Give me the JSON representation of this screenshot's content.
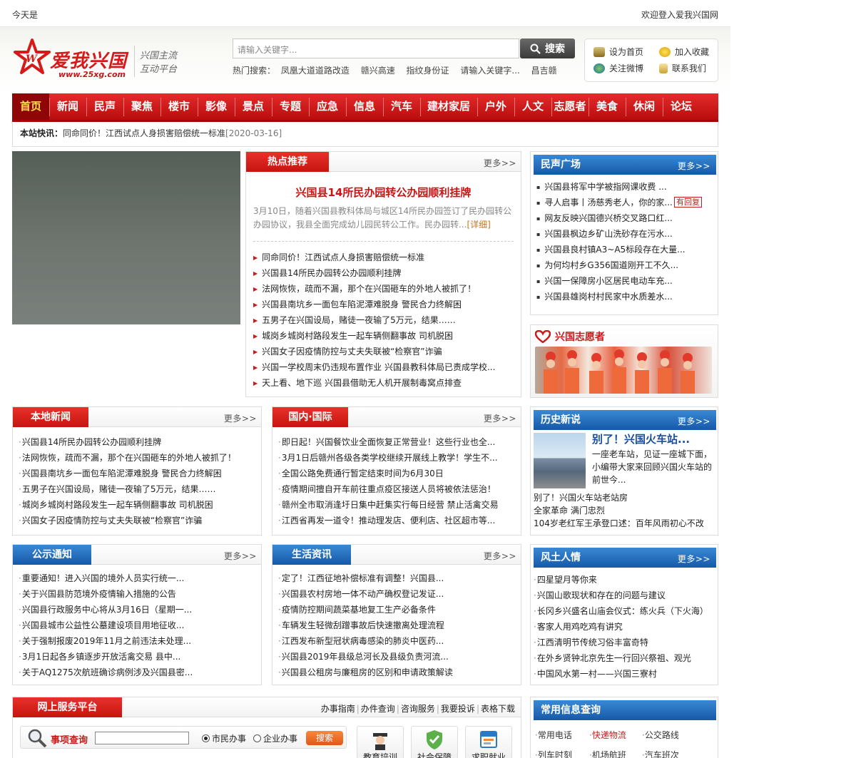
{
  "topbar": {
    "left_text": "今天是",
    "right_text": "欢迎登入爱我兴国网"
  },
  "header": {
    "logo_text": "爱我兴国",
    "logo_url": "www.25xg.com",
    "slogan_1": "兴国主流",
    "slogan_2": "互动平台",
    "search_placeholder": "请输入关键字...",
    "search_button": "搜索",
    "hot_label": "热门搜索：",
    "hot_terms": [
      "凤凰大道道路改造",
      "赣兴高速",
      "指纹身份证",
      "请输入关键字...",
      "昌吉赣"
    ],
    "tools": {
      "homepage": "设为首页",
      "favorite": "加入收藏",
      "weibo": "关注微博",
      "contact": "联系我们"
    }
  },
  "nav": [
    "首页",
    "新闻",
    "民声",
    "聚焦",
    "楼市",
    "影像",
    "景点",
    "专题",
    "应急",
    "信息",
    "汽车",
    "建材家居",
    "户外",
    "人文",
    "志愿者",
    "美食",
    "休闲",
    "论坛"
  ],
  "flash": {
    "label": "本站快讯：",
    "text": "同命同价！江西试点人身损害赔偿统一标准",
    "date": "[2020-03-16]"
  },
  "hot": {
    "tab": "热点推荐",
    "more": "更多>>",
    "title": "兴国县14所民办园转公办园顺利挂牌",
    "desc": "3月10日，随着兴国县教科体局与城区14所民办园签订了民办园转公办园协议，我县全面完成幼儿园民转公工作。民办园转...",
    "detail": "[详细]",
    "items": [
      "同命同价！江西试点人身损害赔偿统一标准",
      "兴国县14所民办园转公办园顺利挂牌",
      "法网恢恢，疏而不漏，那个在兴国砸车的外地人被抓了！",
      "兴国县南坑乡一面包车陷泥潭难脱身 警民合力终解困",
      "五男子在兴国设局，赌徒一夜输了5万元，结果……",
      "城岗乡城岗村路段发生一起车辆侧翻事故 司机脱困",
      "兴国女子因疫情防控与丈夫失联被“检察官”诈骗",
      "兴国一学校周末仍违规布置作业 兴国县教科体局已责成学校...",
      "天上看、地下巡 兴国县借助无人机开展制毒窝点排查"
    ]
  },
  "minsheng": {
    "tab": "民声广场",
    "more": "更多>>",
    "reply_badge": "有回复",
    "items": [
      "兴国县将军中学被指网课收费 ...",
      "寻人启事丨汤慈秀老人，你的家...",
      "网友反映兴国德兴桥交叉路口红...",
      "兴国县枫边乡矿山洗砂存在污水...",
      "兴国县良村镇A3~A5标段存在大量...",
      "为何均村乡G356国道刚开工不久...",
      "兴国一保障房小区居民电动车充...",
      "兴国县雄岗村村民家中水质差水..."
    ]
  },
  "volunteer": {
    "title": "兴国志愿者"
  },
  "local": {
    "tab": "本地新闻",
    "more": "更多>>",
    "items": [
      "兴国县14所民办园转公办园顺利挂牌",
      "法网恢恢，疏而不漏，那个在兴国砸车的外地人被抓了！",
      "兴国县南坑乡一面包车陷泥潭难脱身 警民合力终解困",
      "五男子在兴国设局，赌徒一夜输了5万元，结果……",
      "城岗乡城岗村路段发生一起车辆侧翻事故 司机脱困",
      "兴国女子因疫情防控与丈夫失联被“检察官”诈骗"
    ]
  },
  "domestic": {
    "tab": "国内·国际",
    "more": "更多>>",
    "items": [
      "即日起！兴国餐饮业全面恢复正常营业！这些行业也全...",
      "3月1日后赣州各级各类学校继续开展线上教学！学生不...",
      "全国公路免费通行暂定结束时间为6月30日",
      "疫情期间擅自开车前往重点疫区接送人员将被依法惩治！",
      "赣州全市取消逢圩日集中赶集实行每日经营 禁止活禽交易",
      "江西省再发一道令！推动理发店、便利店、社区超市等..."
    ]
  },
  "history": {
    "tab": "历史新说",
    "more": "更多>>",
    "title": "别了！兴国火车站...",
    "text": "一座老车站，见证一座城下面，小编带大家来回顾兴国火车站的前世今...",
    "items": [
      "别了！兴国火车站老站房",
      "全家革命 满门忠烈",
      "104岁老红军王承登口述：百年风雨初心不改"
    ]
  },
  "notice": {
    "tab": "公示通知",
    "more": "更多>>",
    "items": [
      "重要通知！进入兴国的境外人员实行统一...",
      "关于兴国县防范境外疫情输入措施的公告",
      "兴国县行政服务中心将从3月16日（星期一...",
      "兴国县城市公益性公墓建设项目用地征收...",
      "关于强制报废2019年11月之前违法未处理...",
      "3月1日起各乡镇逐步开放活禽交易 县中...",
      "关于AQ1275次航班确诊病例涉及兴国县密..."
    ]
  },
  "life": {
    "tab": "生活资讯",
    "more": "更多>>",
    "items": [
      "定了！江西征地补偿标准有调整！兴国县...",
      "兴国县农村房地一体不动产确权登记发证...",
      "疫情防控期间蔬菜基地复工生产必备条件",
      "车辆发生轻微刮蹭事故后快速撤离处理流程",
      "江西发布新型冠状病毒感染的肺炎中医药...",
      "兴国县2019年县级总河长及县级负责河流...",
      "兴国县公租房与廉租房的区别和申请政策解读"
    ]
  },
  "customs": {
    "tab": "风土人情",
    "more": "更多>>",
    "items": [
      "四星望月等你来",
      "兴国山歌现状和存在的问题与建议",
      "长冈乡兴盛名山庙会仪式：练火兵（下火海）",
      "客家人用鸡吃鸡有讲究",
      "江西清明节传统习俗丰富奇特",
      "在外乡贤钟北京先生一行回兴祭祖、观光",
      "中国风水第一村——兴国三寮村"
    ]
  },
  "service": {
    "tab": "网上服务平台",
    "links": [
      "办事指南",
      "办件查询",
      "咨询服务",
      "我要投诉",
      "表格下载"
    ],
    "query_label": "事项查询",
    "radio_citizen": "市民办事",
    "radio_company": "企业办事",
    "search_button": "搜索",
    "icons": [
      "教育培训",
      "社会保障",
      "求职就业"
    ]
  },
  "info": {
    "tab": "常用信息查询",
    "items": [
      "常用电话",
      "快递物流",
      "公交路线",
      "列车时刻",
      "机场航班",
      "汽车班次"
    ],
    "highlight_color": "#c81b1b"
  },
  "colors": {
    "brand_red": "#c81b1b",
    "brand_blue": "#1559a8"
  }
}
